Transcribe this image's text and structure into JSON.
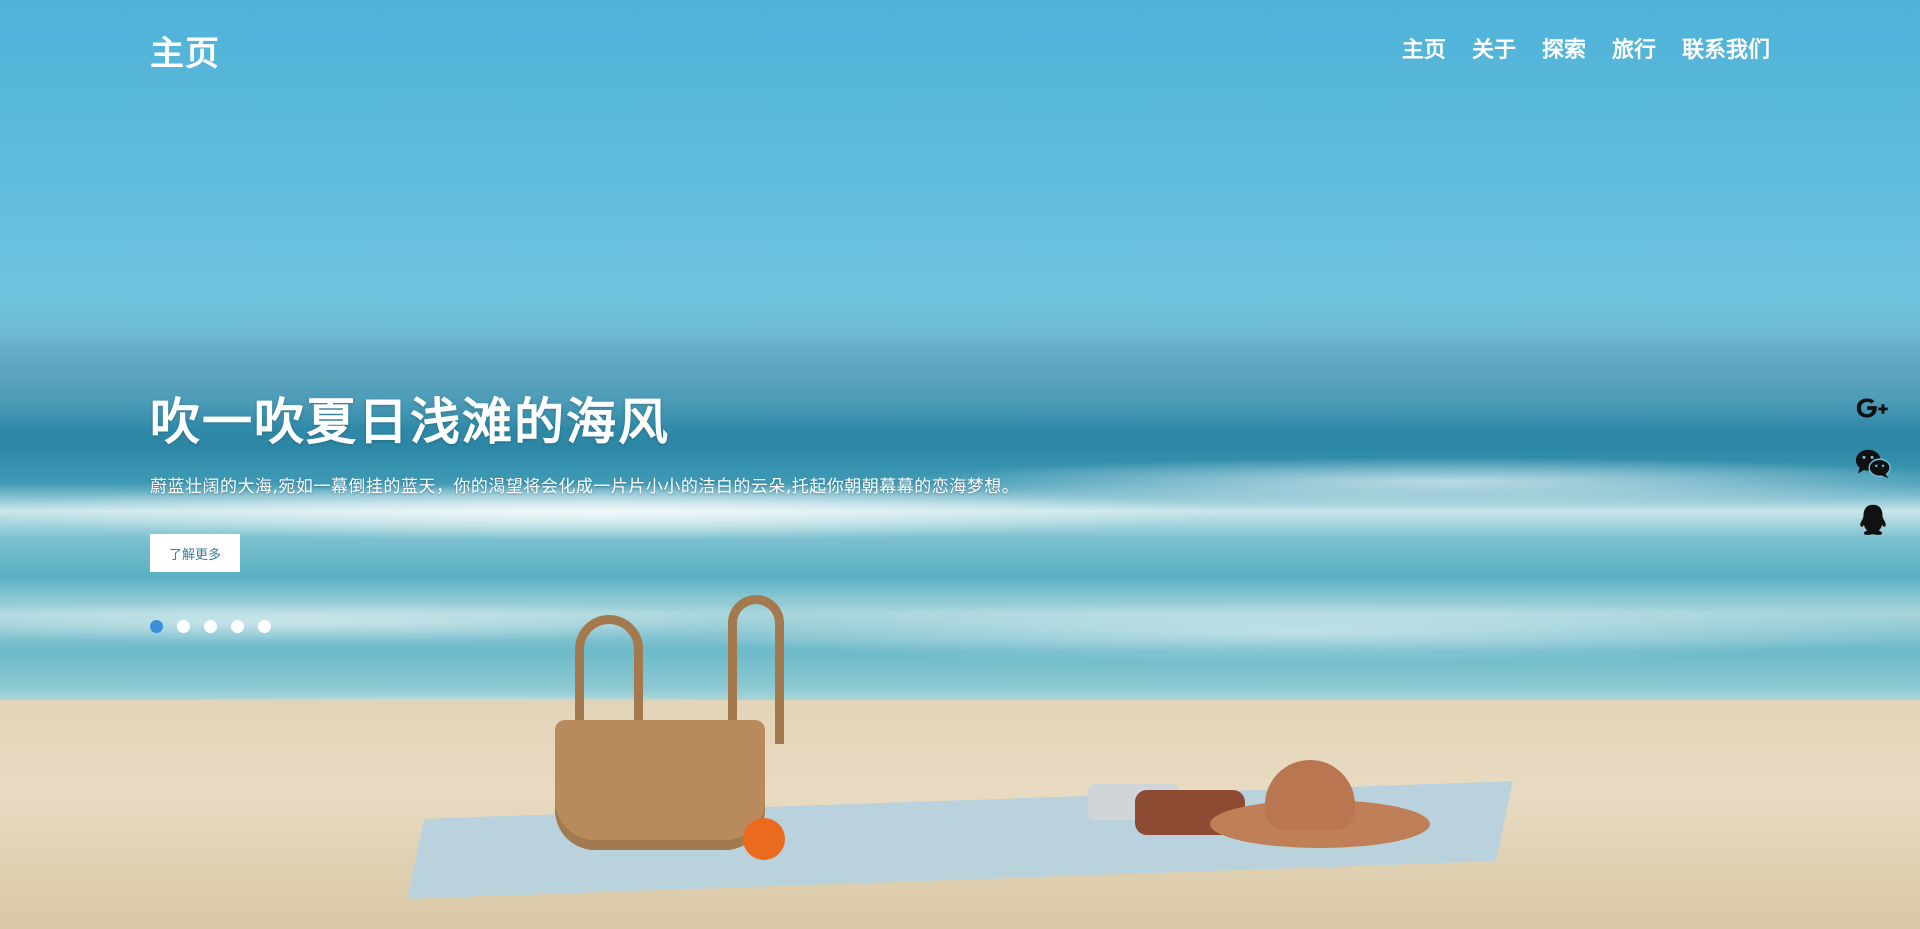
{
  "header": {
    "logo": "主页",
    "nav": [
      "主页",
      "关于",
      "探索",
      "旅行",
      "联系我们"
    ]
  },
  "slide": {
    "headline": "吹一吹夏日浅滩的海风",
    "subtitle": "蔚蓝壮阔的大海,宛如一幕倒挂的蓝天，你的渴望将会化成一片片小小的洁白的云朵,托起你朝朝幕幕的恋海梦想。",
    "cta_label": "了解更多"
  },
  "carousel": {
    "count": 5,
    "active_index": 0
  },
  "social": [
    "google-plus-icon",
    "wechat-icon",
    "qq-icon"
  ],
  "colors": {
    "accent": "#3b8fd8",
    "text": "#ffffff"
  }
}
